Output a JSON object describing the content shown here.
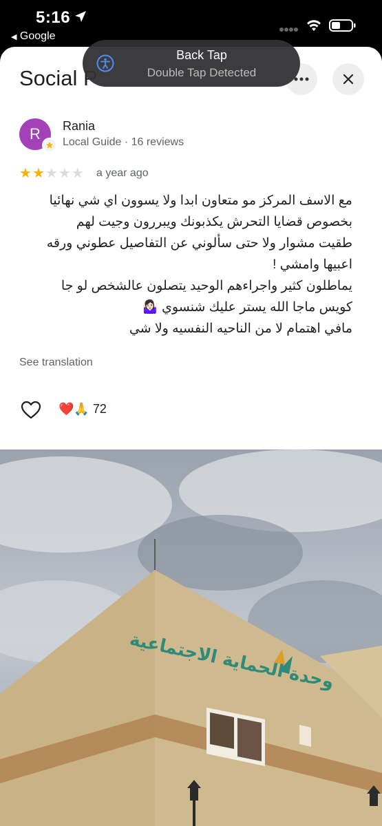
{
  "status_bar": {
    "time": "5:16",
    "back_app": "Google"
  },
  "header": {
    "title": "Social P",
    "more_label": "More options",
    "close_label": "Close"
  },
  "toast": {
    "title": "Back Tap",
    "subtitle": "Double Tap Detected"
  },
  "review": {
    "author": "Rania",
    "avatar_letter": "R",
    "author_meta": "Local Guide · 16 reviews",
    "rating": 2,
    "max_rating": 5,
    "date": "a year ago",
    "lines": [
      "مع الاسف المركز مو متعاون ابدا ولا يسوون اي شي نهائيا",
      "بخصوص قضايا التحرش يكذبونك ويبررون وجيت لهم",
      "طقيت مشوار ولا حتى سألوني عن التفاصيل عطوني ورقه",
      "اعبيها وامشي !",
      "يماطلون كثير واجراءهم الوحيد يتصلون عالشخص لو جا",
      "كويس ماجا الله يستر عليك شنسوي 🤷🏻‍♀️",
      "مافي اهتمام لا من الناحيه النفسيه ولا شي"
    ],
    "translate_link": "See translation",
    "reaction_emojis": "❤️🙏",
    "reaction_count": "72"
  },
  "photo": {
    "sign_arabic": "وحدة الحماية الاجتماعية",
    "colors": {
      "sky": "#b5bcc6",
      "building": "#cdb78b",
      "stripe": "#b0875a",
      "sign": "#2f8a7a"
    }
  }
}
